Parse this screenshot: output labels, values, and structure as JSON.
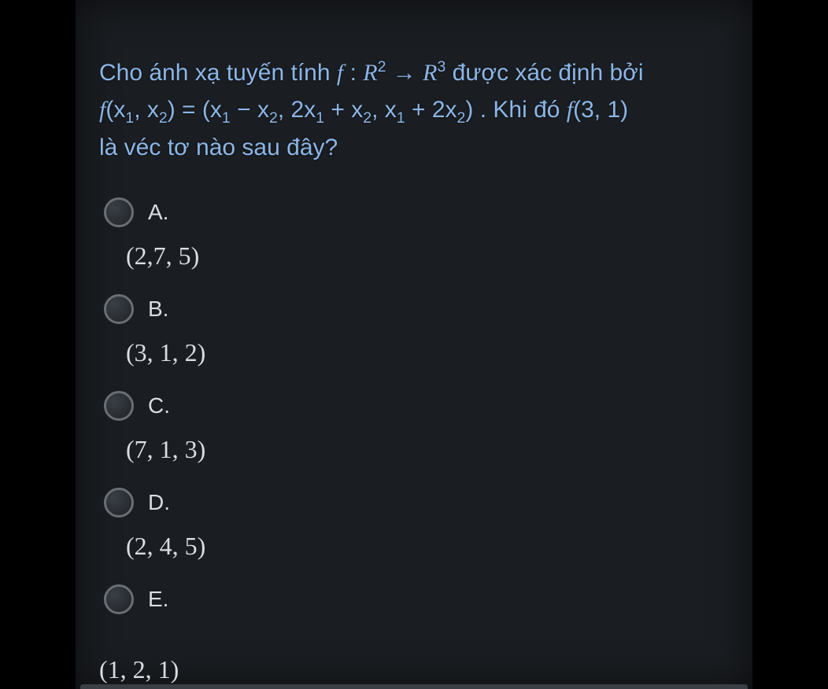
{
  "question": {
    "pre": "Cho ánh xạ tuyến tính ",
    "f": "f",
    "colon": " : ",
    "R": "R",
    "sup2": "2",
    "arrow": " → ",
    "sup3": "3",
    "post1": " được xác định bởi ",
    "line2_a": "f",
    "line2_b": "(x",
    "line2_c": ", x",
    "line2_d": ") = (x",
    "line2_e": " − x",
    "line2_f": ", 2x",
    "line2_g": " + x",
    "line2_h": ", x",
    "line2_i": " + 2x",
    "line2_j": ") . Khi đó ",
    "line2_k": "f",
    "line2_l": "(3, 1)",
    "sub1": "1",
    "sub2": "2",
    "line3": "là véc tơ nào sau đây?"
  },
  "options": [
    {
      "letter": "A.",
      "value": "(2,7, 5)"
    },
    {
      "letter": "B.",
      "value": "(3, 1, 2)"
    },
    {
      "letter": "C.",
      "value": "(7, 1, 3)"
    },
    {
      "letter": "D.",
      "value": "(2, 4, 5)"
    },
    {
      "letter": "E.",
      "value": "(1, 2, 1)"
    }
  ]
}
